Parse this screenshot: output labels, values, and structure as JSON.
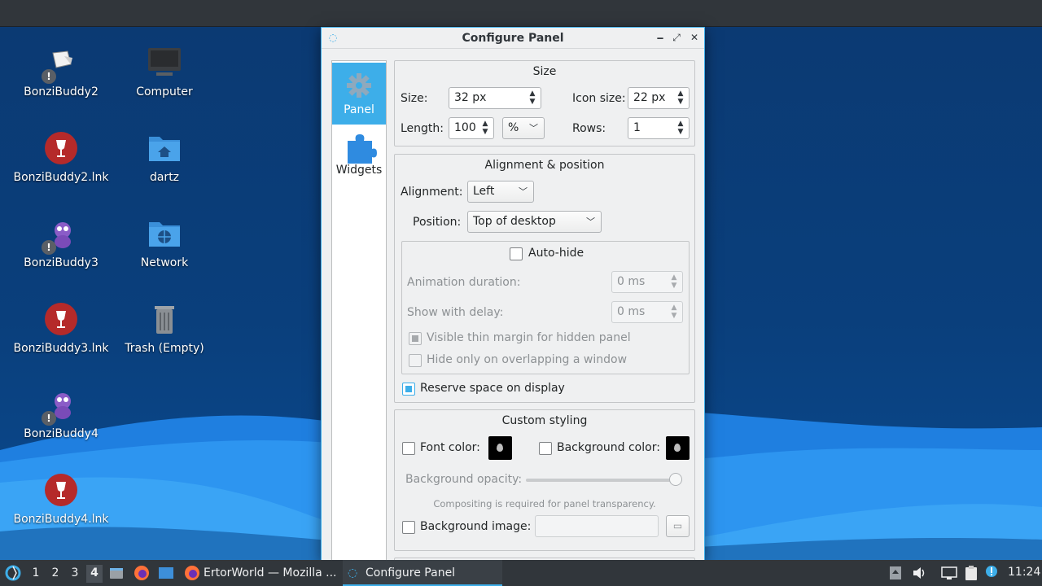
{
  "desktop": {
    "icons": [
      {
        "label": "BonziBuddy2",
        "icon": "bonzi-shortcut-icon"
      },
      {
        "label": "Computer",
        "icon": "computer-icon"
      },
      {
        "label": "BonziBuddy2.lnk",
        "icon": "wine-icon"
      },
      {
        "label": "dartz",
        "icon": "home-folder-icon"
      },
      {
        "label": "BonziBuddy3",
        "icon": "bonzi-shortcut-icon"
      },
      {
        "label": "Network",
        "icon": "network-folder-icon"
      },
      {
        "label": "BonziBuddy3.lnk",
        "icon": "wine-icon"
      },
      {
        "label": "Trash (Empty)",
        "icon": "trash-icon"
      },
      {
        "label": "BonziBuddy4",
        "icon": "bonzi-shortcut-icon"
      },
      {
        "label": "BonziBuddy4.lnk",
        "icon": "wine-icon"
      }
    ],
    "warning_glyph": "!"
  },
  "window": {
    "title": "Configure Panel",
    "buttons": {
      "minimize": "🗕",
      "maximize": "⤢",
      "close": "✕"
    },
    "sidebar": [
      {
        "label": "Panel",
        "icon": "gear-icon",
        "active": true
      },
      {
        "label": "Widgets",
        "icon": "puzzle-icon",
        "active": false
      }
    ],
    "size_group": {
      "title": "Size",
      "size_label": "Size:",
      "size_value": "32 px",
      "icon_size_label": "Icon size:",
      "icon_size_value": "22 px",
      "length_label": "Length:",
      "length_value": "100",
      "length_unit": "%",
      "rows_label": "Rows:",
      "rows_value": "1"
    },
    "alignment_group": {
      "title": "Alignment & position",
      "alignment_label": "Alignment:",
      "alignment_value": "Left",
      "position_label": "Position:",
      "position_value": "Top of desktop",
      "autohide_label": "Auto-hide",
      "autohide_checked": false,
      "animation_label": "Animation duration:",
      "animation_value": "0 ms",
      "delay_label": "Show with delay:",
      "delay_value": "0 ms",
      "thin_margin_label": "Visible thin margin for hidden panel",
      "overlap_label": "Hide only on overlapping a window",
      "reserve_label": "Reserve space on display",
      "reserve_checked": true
    },
    "styling_group": {
      "title": "Custom styling",
      "font_color_label": "Font color:",
      "bg_color_label": "Background color:",
      "opacity_label": "Background opacity:",
      "opacity_value": 1.0,
      "compositing_note": "Compositing is required for panel transparency.",
      "bg_image_label": "Background image:",
      "bg_image_value": ""
    }
  },
  "taskbar": {
    "workspaces": [
      "1",
      "2",
      "3",
      "4"
    ],
    "active_workspace": "4",
    "tasks": [
      {
        "label": "ErtorWorld — Mozilla ...",
        "icon": "firefox-icon",
        "active": false
      },
      {
        "label": "Configure Panel",
        "icon": "lxqt-icon",
        "active": true
      }
    ],
    "clock": "11:24"
  },
  "colors": {
    "accent": "#3daee9",
    "taskbar": "#31363b",
    "window_bg": "#eff0f1"
  }
}
